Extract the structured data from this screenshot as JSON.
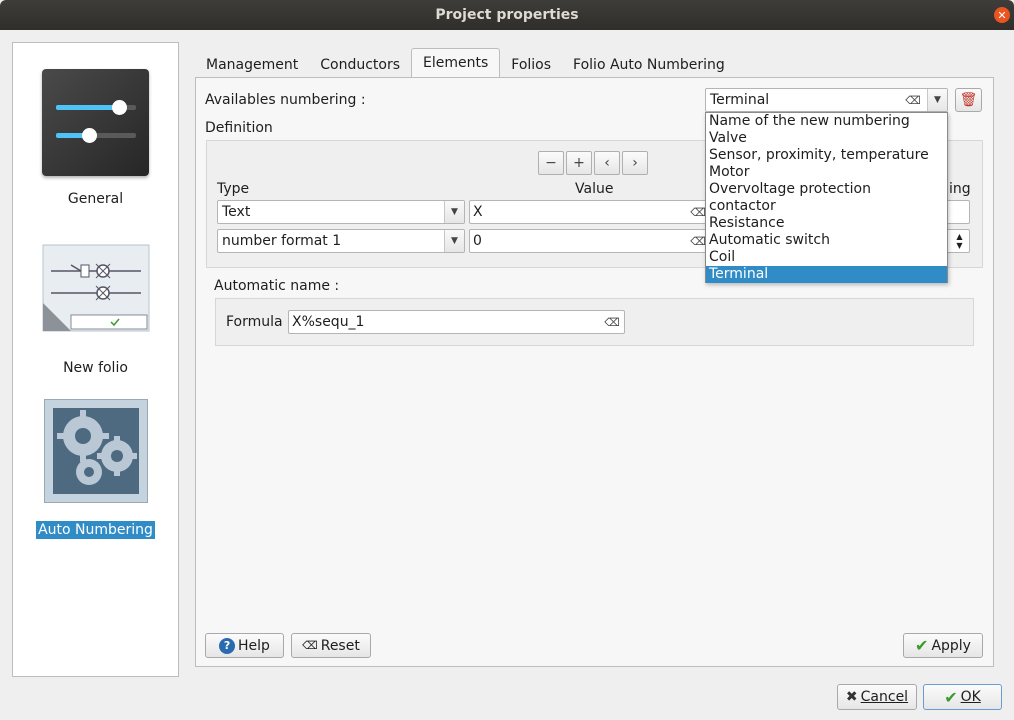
{
  "window": {
    "title": "Project properties"
  },
  "sidebar": {
    "items": [
      {
        "label": "General",
        "icon": "sliders-icon"
      },
      {
        "label": "New folio",
        "icon": "folio-schematic-icon"
      },
      {
        "label": "Auto Numbering",
        "icon": "gears-icon",
        "selected": true
      }
    ]
  },
  "tabs": [
    {
      "label": "Management"
    },
    {
      "label": "Conductors"
    },
    {
      "label": "Elements",
      "active": true
    },
    {
      "label": "Folios"
    },
    {
      "label": "Folio Auto Numbering"
    }
  ],
  "elements_tab": {
    "availables_label": "Availables numbering :",
    "numbering_select": {
      "value": "Terminal",
      "options": [
        "Name of the new numbering",
        "Valve",
        "Sensor, proximity, temperature",
        "Motor",
        "Overvoltage protection",
        "contactor",
        "Resistance",
        "Automatic switch",
        "Coil",
        "Terminal"
      ],
      "selected_index": 9
    },
    "definition_label": "Definition",
    "columns": {
      "type": "Type",
      "value": "Value",
      "increase_partial": "ing"
    },
    "rows": [
      {
        "type": "Text",
        "value": "X"
      },
      {
        "type": "number format 1",
        "value": "0"
      }
    ],
    "automatic_name_label": "Automatic name :",
    "formula_label": "Formula",
    "formula_value": "X%sequ_1",
    "buttons": {
      "help": "Help",
      "reset": "Reset",
      "apply": "Apply"
    }
  },
  "dialog_buttons": {
    "cancel": "Cancel",
    "ok": "OK"
  },
  "colors": {
    "selection": "#308cc6",
    "titlebar": "#2f2e2b",
    "close": "#e95420"
  }
}
